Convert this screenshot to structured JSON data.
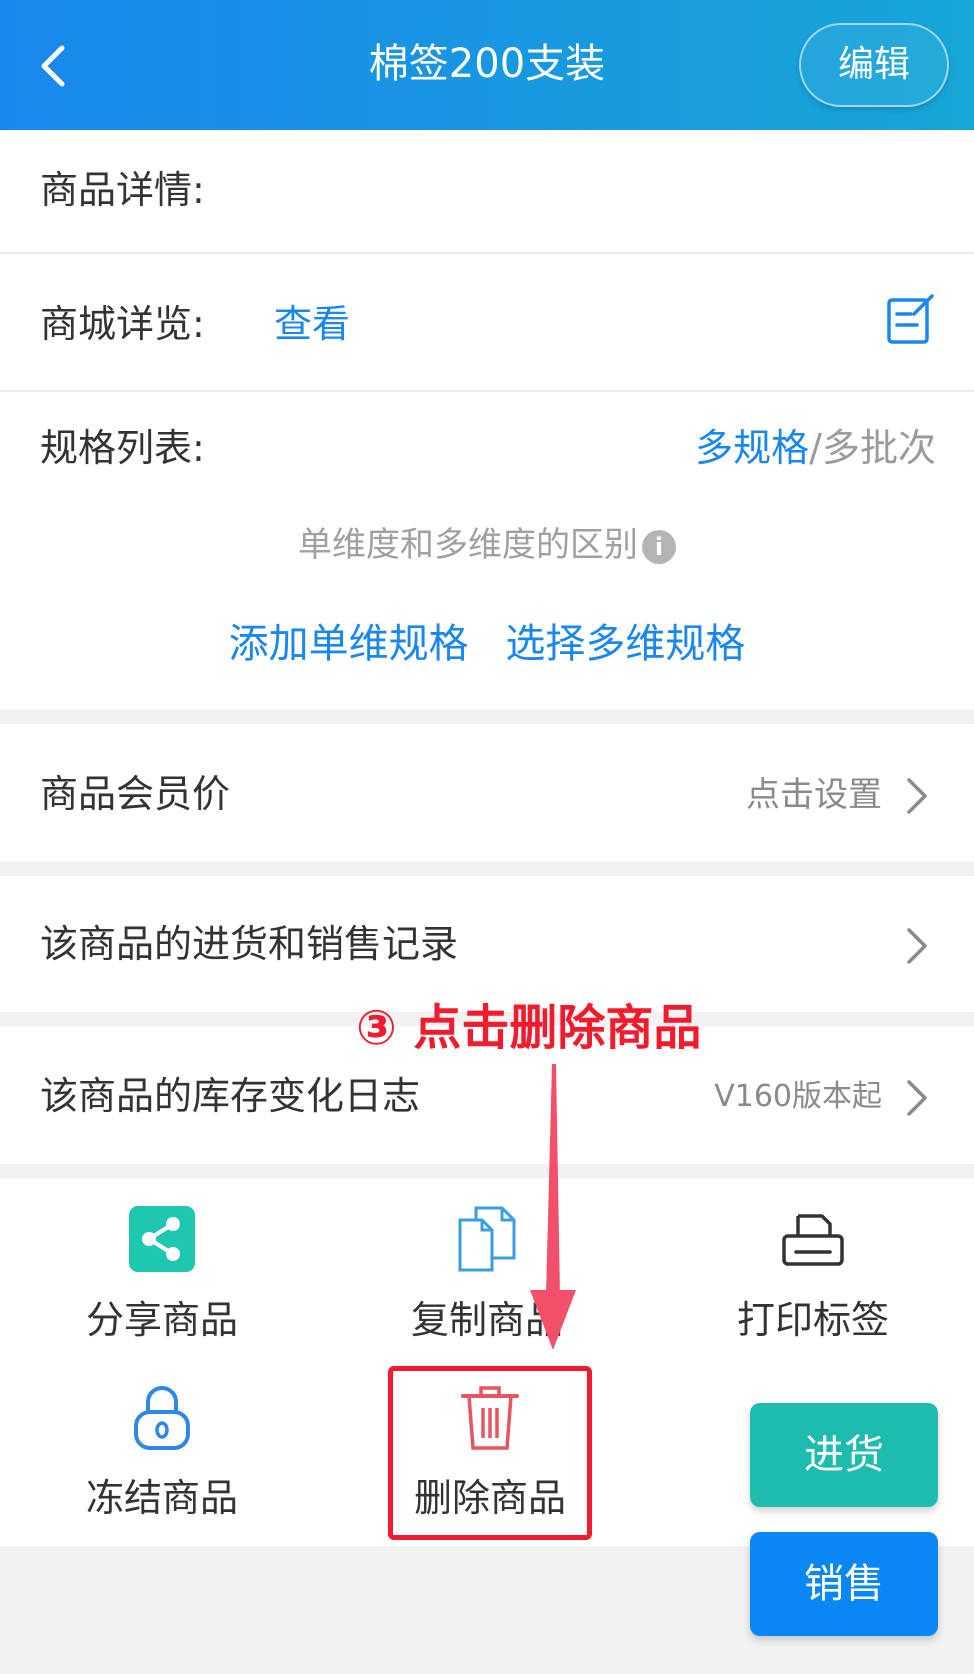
{
  "header": {
    "title": "棉签200支装",
    "edit_label": "编辑"
  },
  "details": {
    "label": "商品详情:"
  },
  "mall_preview": {
    "label": "商城详览:",
    "link": "查看"
  },
  "spec_list": {
    "label": "规格列表:",
    "multi_spec": "多规格",
    "separator": "/",
    "multi_batch": "多批次",
    "difference_text": "单维度和多维度的区别",
    "info_glyph": "i",
    "add_single": "添加单维规格",
    "choose_multi": "选择多维规格"
  },
  "member_price": {
    "label": "商品会员价",
    "value": "点击设置"
  },
  "records": {
    "label": "该商品的进货和销售记录"
  },
  "stock_log": {
    "label": "该商品的库存变化日志",
    "value": "V160版本起"
  },
  "actions": {
    "share": "分享商品",
    "copy": "复制商品",
    "print": "打印标签",
    "freeze": "冻结商品",
    "delete": "删除商品"
  },
  "annotation": {
    "text": "③ 点击删除商品"
  },
  "floating": {
    "stock": "进货",
    "sell": "销售"
  },
  "colors": {
    "header_start": "#1a87ee",
    "header_end": "#17a6d6",
    "link": "#1a87ee",
    "share_green": "#1ec8b0",
    "delete_red": "#e8545f",
    "annotation_red": "#f21b2d",
    "stock_button": "#1ebcae",
    "sell_button": "#0a86f5"
  }
}
